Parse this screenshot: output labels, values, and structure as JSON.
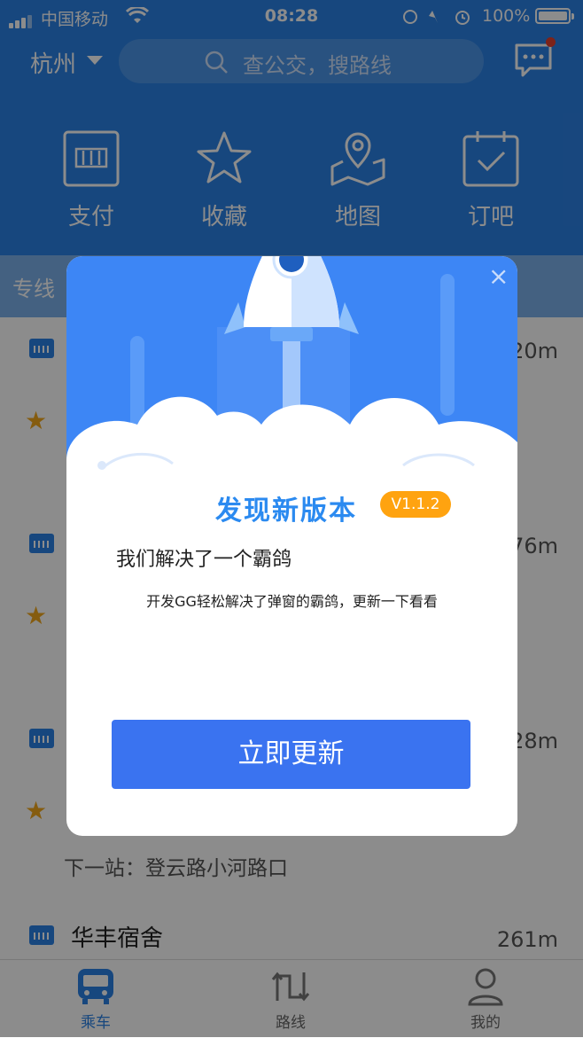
{
  "status_bar": {
    "carrier": "中国移动",
    "time": "08:28",
    "battery": "100%"
  },
  "header": {
    "city": "杭州",
    "search_placeholder": "查公交，搜路线"
  },
  "quick_actions": [
    {
      "label": "支付",
      "icon": "bus-card-icon"
    },
    {
      "label": "收藏",
      "icon": "star-icon"
    },
    {
      "label": "地图",
      "icon": "map-icon"
    },
    {
      "label": "订吧",
      "icon": "calendar-check-icon"
    }
  ],
  "list": {
    "partial_title": "专线",
    "items": [
      {
        "distance": "20m"
      },
      {
        "distance": "76m"
      },
      {
        "distance": "28m"
      },
      {
        "next_stop": "下一站：登云路小河路口"
      },
      {
        "name": "华丰宿舍",
        "distance": "261m"
      }
    ]
  },
  "tabs": [
    {
      "label": "乘车",
      "active": true
    },
    {
      "label": "路线",
      "active": false
    },
    {
      "label": "我的",
      "active": false
    }
  ],
  "modal": {
    "close": "×",
    "title": "发现新版本",
    "version": "V1.1.2",
    "heading": "我们解决了一个霸鸽",
    "description": "开发GG轻松解决了弹窗的霸鸽，更新一下看看",
    "button": "立即更新"
  },
  "colors": {
    "primary": "#2b82e6",
    "accent": "#ffa310",
    "button": "#3a73f0"
  }
}
